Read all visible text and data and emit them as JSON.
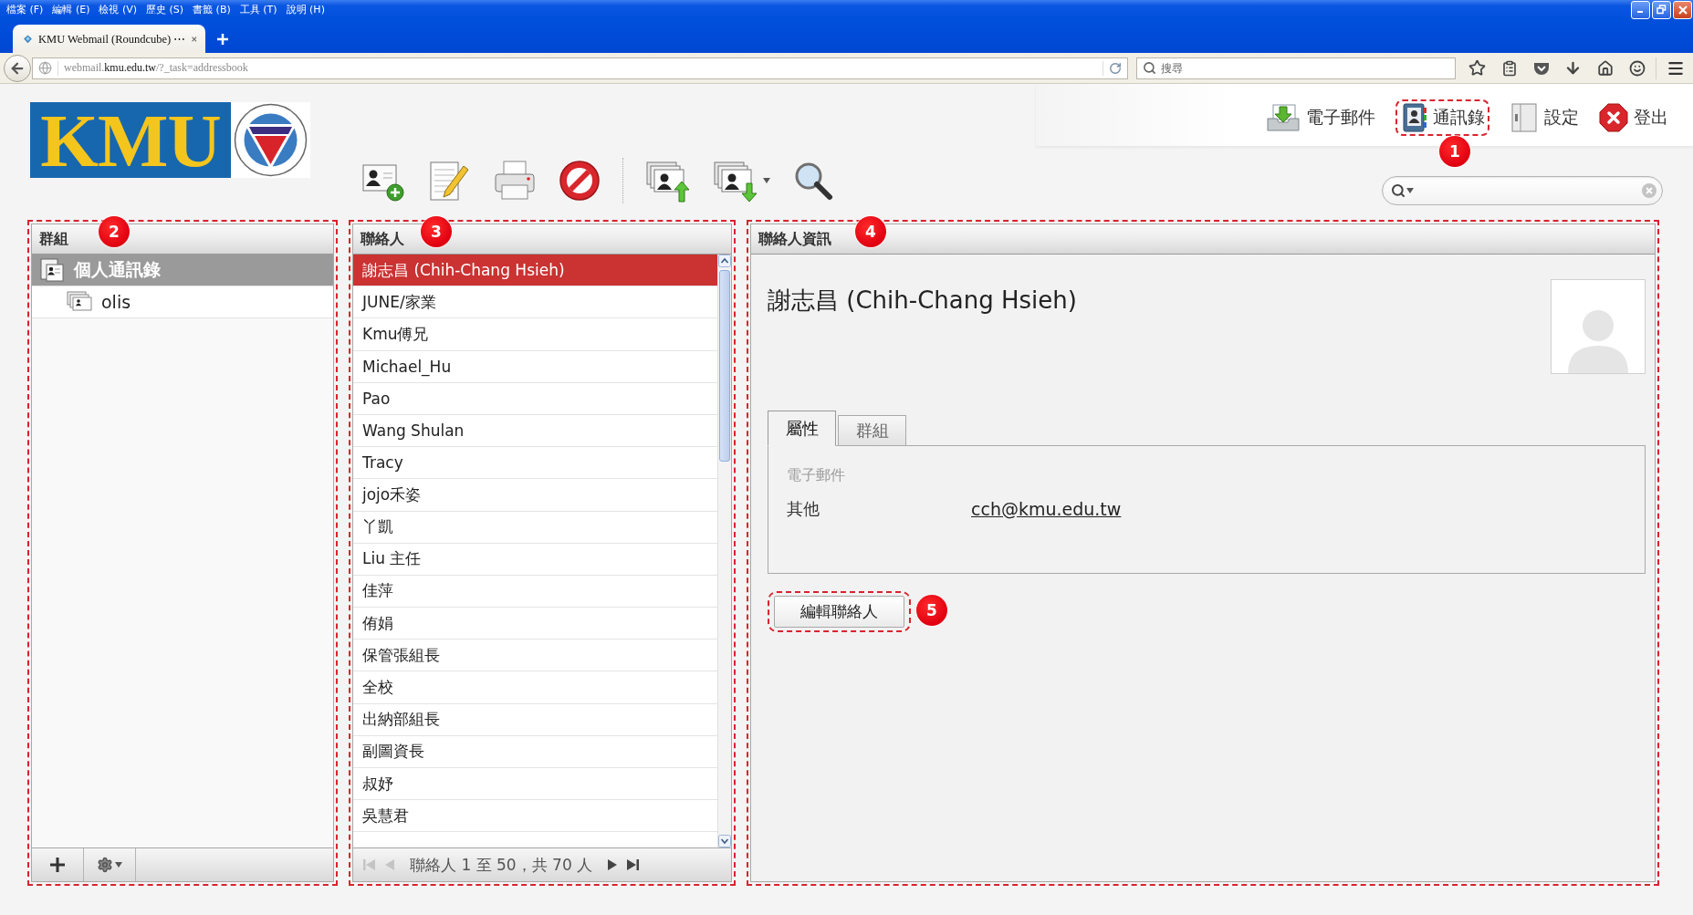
{
  "browser": {
    "menu": [
      "檔案 (F)",
      "編輯 (E)",
      "檢視 (V)",
      "歷史 (S)",
      "書籤 (B)",
      "工具 (T)",
      "說明 (H)"
    ],
    "tab": {
      "title": "KMU Webmail (Roundcube) ⋯"
    },
    "url": "webmail.**kmu.edu.tw**/?_task=addressbook",
    "search": {
      "placeholder": "搜尋"
    }
  },
  "header": {
    "logo": "KMU",
    "tasks": [
      {
        "kind": "mail",
        "label": "電子郵件"
      },
      {
        "kind": "addressbook",
        "label": "通訊錄",
        "annotation": "1"
      },
      {
        "kind": "settings",
        "label": "設定"
      },
      {
        "kind": "logout",
        "label": "登出"
      }
    ]
  },
  "groups_panel": {
    "title": "群組",
    "annotation": "2",
    "items": [
      {
        "label": "個人通訊錄",
        "selected": true,
        "children": [
          {
            "label": "olis",
            "selected": false
          }
        ]
      }
    ]
  },
  "contacts_panel": {
    "title": "聯絡人",
    "annotation": "3",
    "rows": [
      {
        "name": "謝志昌 (Chih-Chang Hsieh)",
        "selected": true
      },
      {
        "name": "JUNE/家業",
        "selected": false
      },
      {
        "name": "Kmu傅兄",
        "selected": false
      },
      {
        "name": "Michael_Hu",
        "selected": false
      },
      {
        "name": "Pao",
        "selected": false
      },
      {
        "name": "Wang Shulan",
        "selected": false
      },
      {
        "name": "Tracy",
        "selected": false
      },
      {
        "name": "jojo禾姿",
        "selected": false
      },
      {
        "name": "丫凱",
        "selected": false
      },
      {
        "name": "Liu 主任",
        "selected": false
      },
      {
        "name": "佳萍",
        "selected": false
      },
      {
        "name": "侑娟",
        "selected": false
      },
      {
        "name": "保管張組長",
        "selected": false
      },
      {
        "name": "全校",
        "selected": false
      },
      {
        "name": "出納部組長",
        "selected": false
      },
      {
        "name": "副圖資長",
        "selected": false
      },
      {
        "name": "叔妤",
        "selected": false
      },
      {
        "name": "吳慧君",
        "selected": false
      }
    ],
    "pager": {
      "label": "聯絡人 1 至 50，共 70 人",
      "buttons": [
        {
          "kind": "first",
          "disabled": true
        },
        {
          "kind": "prev",
          "disabled": true
        },
        {
          "kind": "next",
          "disabled": false
        },
        {
          "kind": "last",
          "disabled": false
        }
      ]
    }
  },
  "contact": {
    "title": "聯絡人資訊",
    "annotation": "4",
    "name": "謝志昌 (Chih-Chang Hsieh)",
    "tabs": [
      {
        "label": "屬性",
        "selected": true
      },
      {
        "label": "群組",
        "selected": false
      }
    ],
    "sections": [
      {
        "title": "電子郵件",
        "fields": [
          {
            "label": "其他",
            "value": "cch@kmu.edu.tw"
          }
        ]
      }
    ],
    "edit_button": {
      "label": "編輯聯絡人",
      "annotation": "5"
    }
  }
}
